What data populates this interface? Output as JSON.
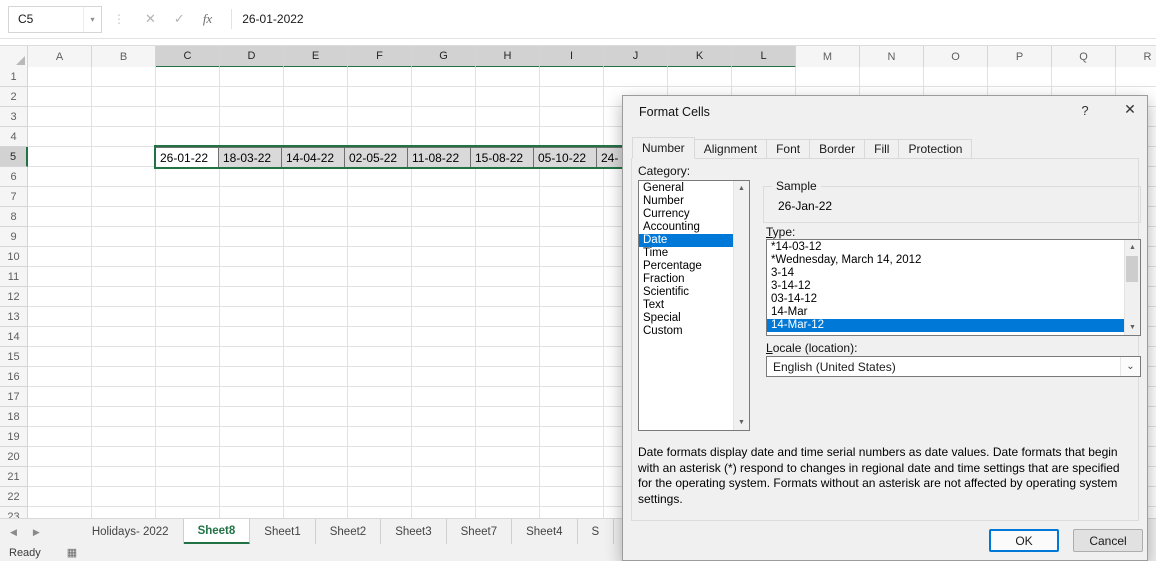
{
  "formula_bar": {
    "name_box": "C5",
    "formula": "26-01-2022"
  },
  "icons": {
    "name_box_chevron": "▾",
    "more_dots": "⋮",
    "cancel": "✕",
    "enter": "✓",
    "fx": "fx",
    "nav_left": "◀",
    "nav_right": "▶",
    "macro": "▦",
    "dialog_help": "?",
    "dialog_close": "✕",
    "scroll_up": "▲",
    "scroll_down": "▼",
    "combo_chevron": "⌄",
    "corner_triangle": ""
  },
  "grid": {
    "columns": [
      "A",
      "B",
      "C",
      "D",
      "E",
      "F",
      "G",
      "H",
      "I",
      "J",
      "K",
      "L",
      "M",
      "N",
      "O",
      "P",
      "Q",
      "R"
    ],
    "rows": [
      "1",
      "2",
      "3",
      "4",
      "5",
      "6",
      "7",
      "8",
      "9",
      "10",
      "11",
      "12",
      "13",
      "14",
      "15",
      "16",
      "17",
      "18",
      "19",
      "20",
      "21",
      "22",
      "23"
    ],
    "selection": {
      "row": "5",
      "col_start": "C",
      "col_end": "L",
      "active_col": "C"
    },
    "row5_dates": [
      "26-01-22",
      "18-03-22",
      "14-04-22",
      "02-05-22",
      "11-08-22",
      "15-08-22",
      "05-10-22",
      "24-"
    ]
  },
  "sheet_tabs": {
    "tabs": [
      "Holidays- 2022",
      "Sheet8",
      "Sheet1",
      "Sheet2",
      "Sheet3",
      "Sheet7",
      "Sheet4",
      "S"
    ],
    "active": "Sheet8"
  },
  "status_bar": {
    "ready": "Ready"
  },
  "dialog": {
    "title": "Format Cells",
    "tabs": [
      "Number",
      "Alignment",
      "Font",
      "Border",
      "Fill",
      "Protection"
    ],
    "active_tab": "Number",
    "category_label": "Category:",
    "categories": [
      "General",
      "Number",
      "Currency",
      "Accounting",
      "Date",
      "Time",
      "Percentage",
      "Fraction",
      "Scientific",
      "Text",
      "Special",
      "Custom"
    ],
    "selected_category": "Date",
    "sample_label": "Sample",
    "sample_value": "26-Jan-22",
    "type_label": "Type:",
    "types": [
      "*14-03-12",
      "*Wednesday, March 14, 2012",
      "3-14",
      "3-14-12",
      "03-14-12",
      "14-Mar",
      "14-Mar-12"
    ],
    "selected_type": "14-Mar-12",
    "locale_label": "Locale (location):",
    "locale_value": "English (United States)",
    "description": "Date formats display date and time serial numbers as date values.  Date formats that begin with an asterisk (*) respond to changes in regional date and time settings that are specified for the operating system. Formats without an asterisk are not affected by operating system settings.",
    "ok_label": "OK",
    "cancel_label": "Cancel"
  }
}
